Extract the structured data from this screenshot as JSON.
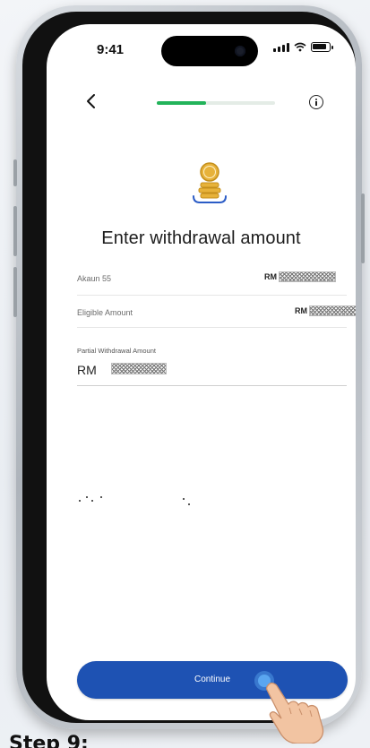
{
  "status_bar": {
    "time": "9:41"
  },
  "header": {
    "progress_fraction": 0.42
  },
  "icons": {
    "back": "chevron-left-icon",
    "info": "info-icon",
    "coin": "coin-stack-icon",
    "signal": "signal-icon",
    "wifi": "wifi-icon",
    "battery": "battery-icon"
  },
  "page": {
    "title": "Enter withdrawal amount"
  },
  "account_row": {
    "label": "Akaun 55",
    "currency": "RM"
  },
  "eligible_row": {
    "label": "Eligible Amount",
    "currency": "RM"
  },
  "withdrawal_input": {
    "label": "Partial Withdrawal Amount",
    "prefix": "RM"
  },
  "footer": {
    "continue_label": "Continue"
  },
  "caption": {
    "step": "Step 9:"
  },
  "colors": {
    "accent": "#1e52b3",
    "progress": "#22b35a",
    "tap_indicator": "#5aa6f0"
  }
}
